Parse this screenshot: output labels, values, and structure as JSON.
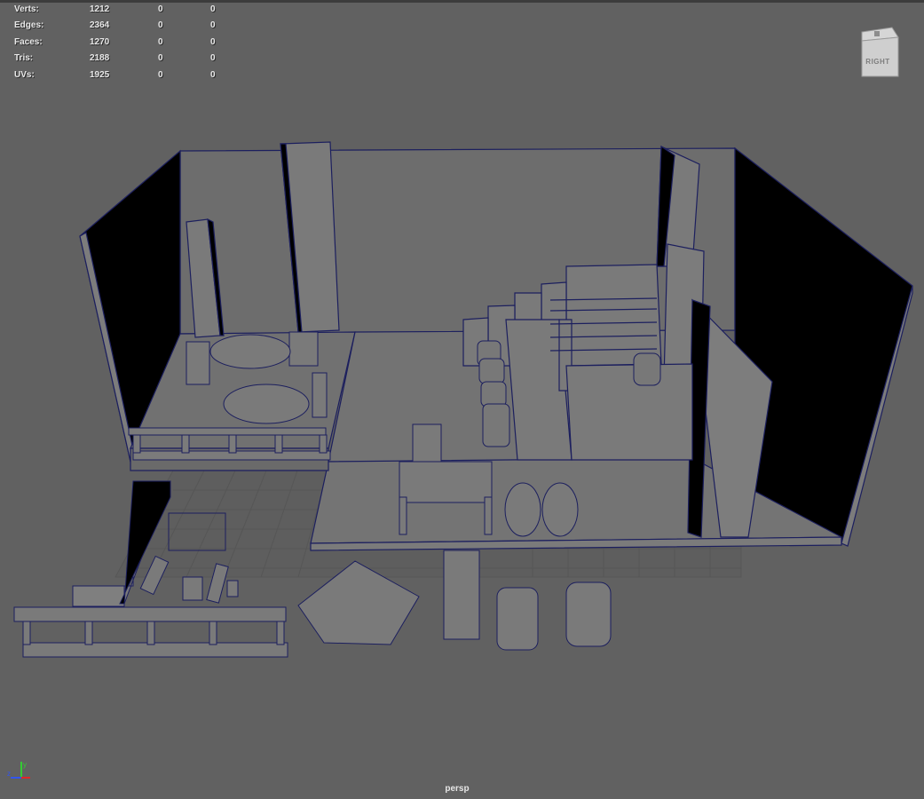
{
  "hud": {
    "rows": [
      {
        "label": "Verts:",
        "values": [
          "1212",
          "0",
          "0"
        ]
      },
      {
        "label": "Edges:",
        "values": [
          "2364",
          "0",
          "0"
        ]
      },
      {
        "label": "Faces:",
        "values": [
          "1270",
          "0",
          "0"
        ]
      },
      {
        "label": "Tris:",
        "values": [
          "2188",
          "0",
          "0"
        ]
      },
      {
        "label": "UVs:",
        "values": [
          "1925",
          "0",
          "0"
        ]
      }
    ]
  },
  "viewcube": {
    "label": "RIGHT",
    "icon": "view-cube-icon"
  },
  "camera": {
    "name": "persp"
  },
  "axis_gizmo": {
    "icon": "xyz-axis-icon",
    "x": "x",
    "y": "y",
    "z": "z"
  },
  "colors": {
    "viewport_bg": "#616161",
    "wireframe": "#1c1f5e",
    "surface": "#6f6f6f",
    "shadow": "#000000",
    "hud_text": "#e8e8e8",
    "axis_x": "#e02828",
    "axis_y": "#33cc33",
    "axis_z": "#3355ee"
  }
}
